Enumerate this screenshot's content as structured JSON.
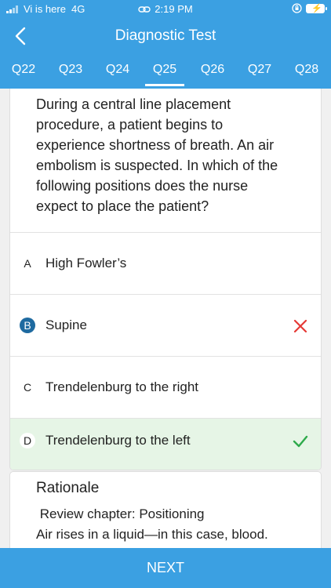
{
  "status": {
    "carrier": "Vi is here",
    "network": "4G",
    "time": "2:19 PM"
  },
  "header": {
    "title": "Diagnostic Test"
  },
  "tabs": [
    "Q22",
    "Q23",
    "Q24",
    "Q25",
    "Q26",
    "Q27",
    "Q28"
  ],
  "active_tab": "Q25",
  "question": {
    "lines": [
      "During a central line placement",
      "procedure, a patient begins to",
      "experience shortness of breath. An air",
      "embolism is suspected. In which of the",
      "following positions does the nurse",
      "expect to place the patient?"
    ]
  },
  "options": [
    {
      "letter": "A",
      "label": "High Fowler’s"
    },
    {
      "letter": "B",
      "label": "Supine"
    },
    {
      "letter": "C",
      "label": "Trendelenburg to the right"
    },
    {
      "letter": "D",
      "label": "Trendelenburg to the left"
    }
  ],
  "selected_option": "B",
  "correct_option": "D",
  "colors": {
    "accent": "#3ba0e2",
    "wrong": "#e53935",
    "correct": "#2eaa4b",
    "correct_bg": "#e6f5e6"
  },
  "rationale": {
    "title": "Rationale",
    "lines": [
      " Review chapter: Positioning",
      "Air rises in a liquid—in this case, blood."
    ]
  },
  "footer": {
    "next_label": "NEXT"
  }
}
